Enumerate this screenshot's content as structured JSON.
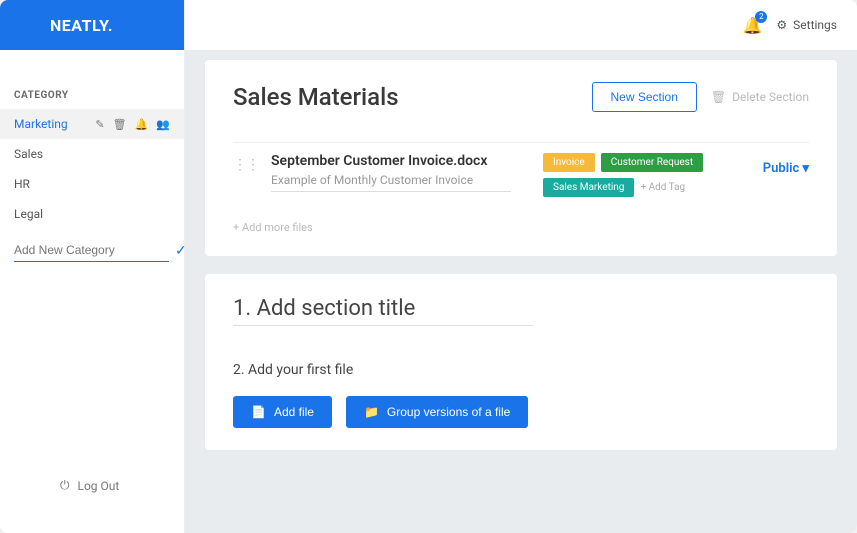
{
  "brand": "NEATLY.",
  "sidebar": {
    "heading": "CATEGORY",
    "items": [
      {
        "label": "Marketing",
        "selected": true
      },
      {
        "label": "Sales",
        "selected": false
      },
      {
        "label": "HR",
        "selected": false
      },
      {
        "label": "Legal",
        "selected": false
      }
    ],
    "add_placeholder": "Add New Category",
    "logout": "Log Out"
  },
  "topbar": {
    "notif_count": "2",
    "settings_label": "Settings"
  },
  "page": {
    "title": "Sales Materials",
    "new_section": "New Section",
    "delete_section": "Delete Section"
  },
  "file": {
    "name": "September Customer Invoice.docx",
    "desc": "Example of Monthly Customer Invoice",
    "tags": [
      {
        "label": "Invoice",
        "color": "#f6b93b"
      },
      {
        "label": "Customer Request",
        "color": "#2e9e44"
      },
      {
        "label": "Sales Marketing",
        "color": "#1baaa0"
      }
    ],
    "add_tag": "+ Add Tag",
    "visibility": "Public",
    "add_more": "+   Add more files"
  },
  "section2": {
    "title": "1. Add section title",
    "subtitle": "2. Add your first file",
    "add_file": "Add file",
    "group_versions": "Group versions of a file"
  }
}
